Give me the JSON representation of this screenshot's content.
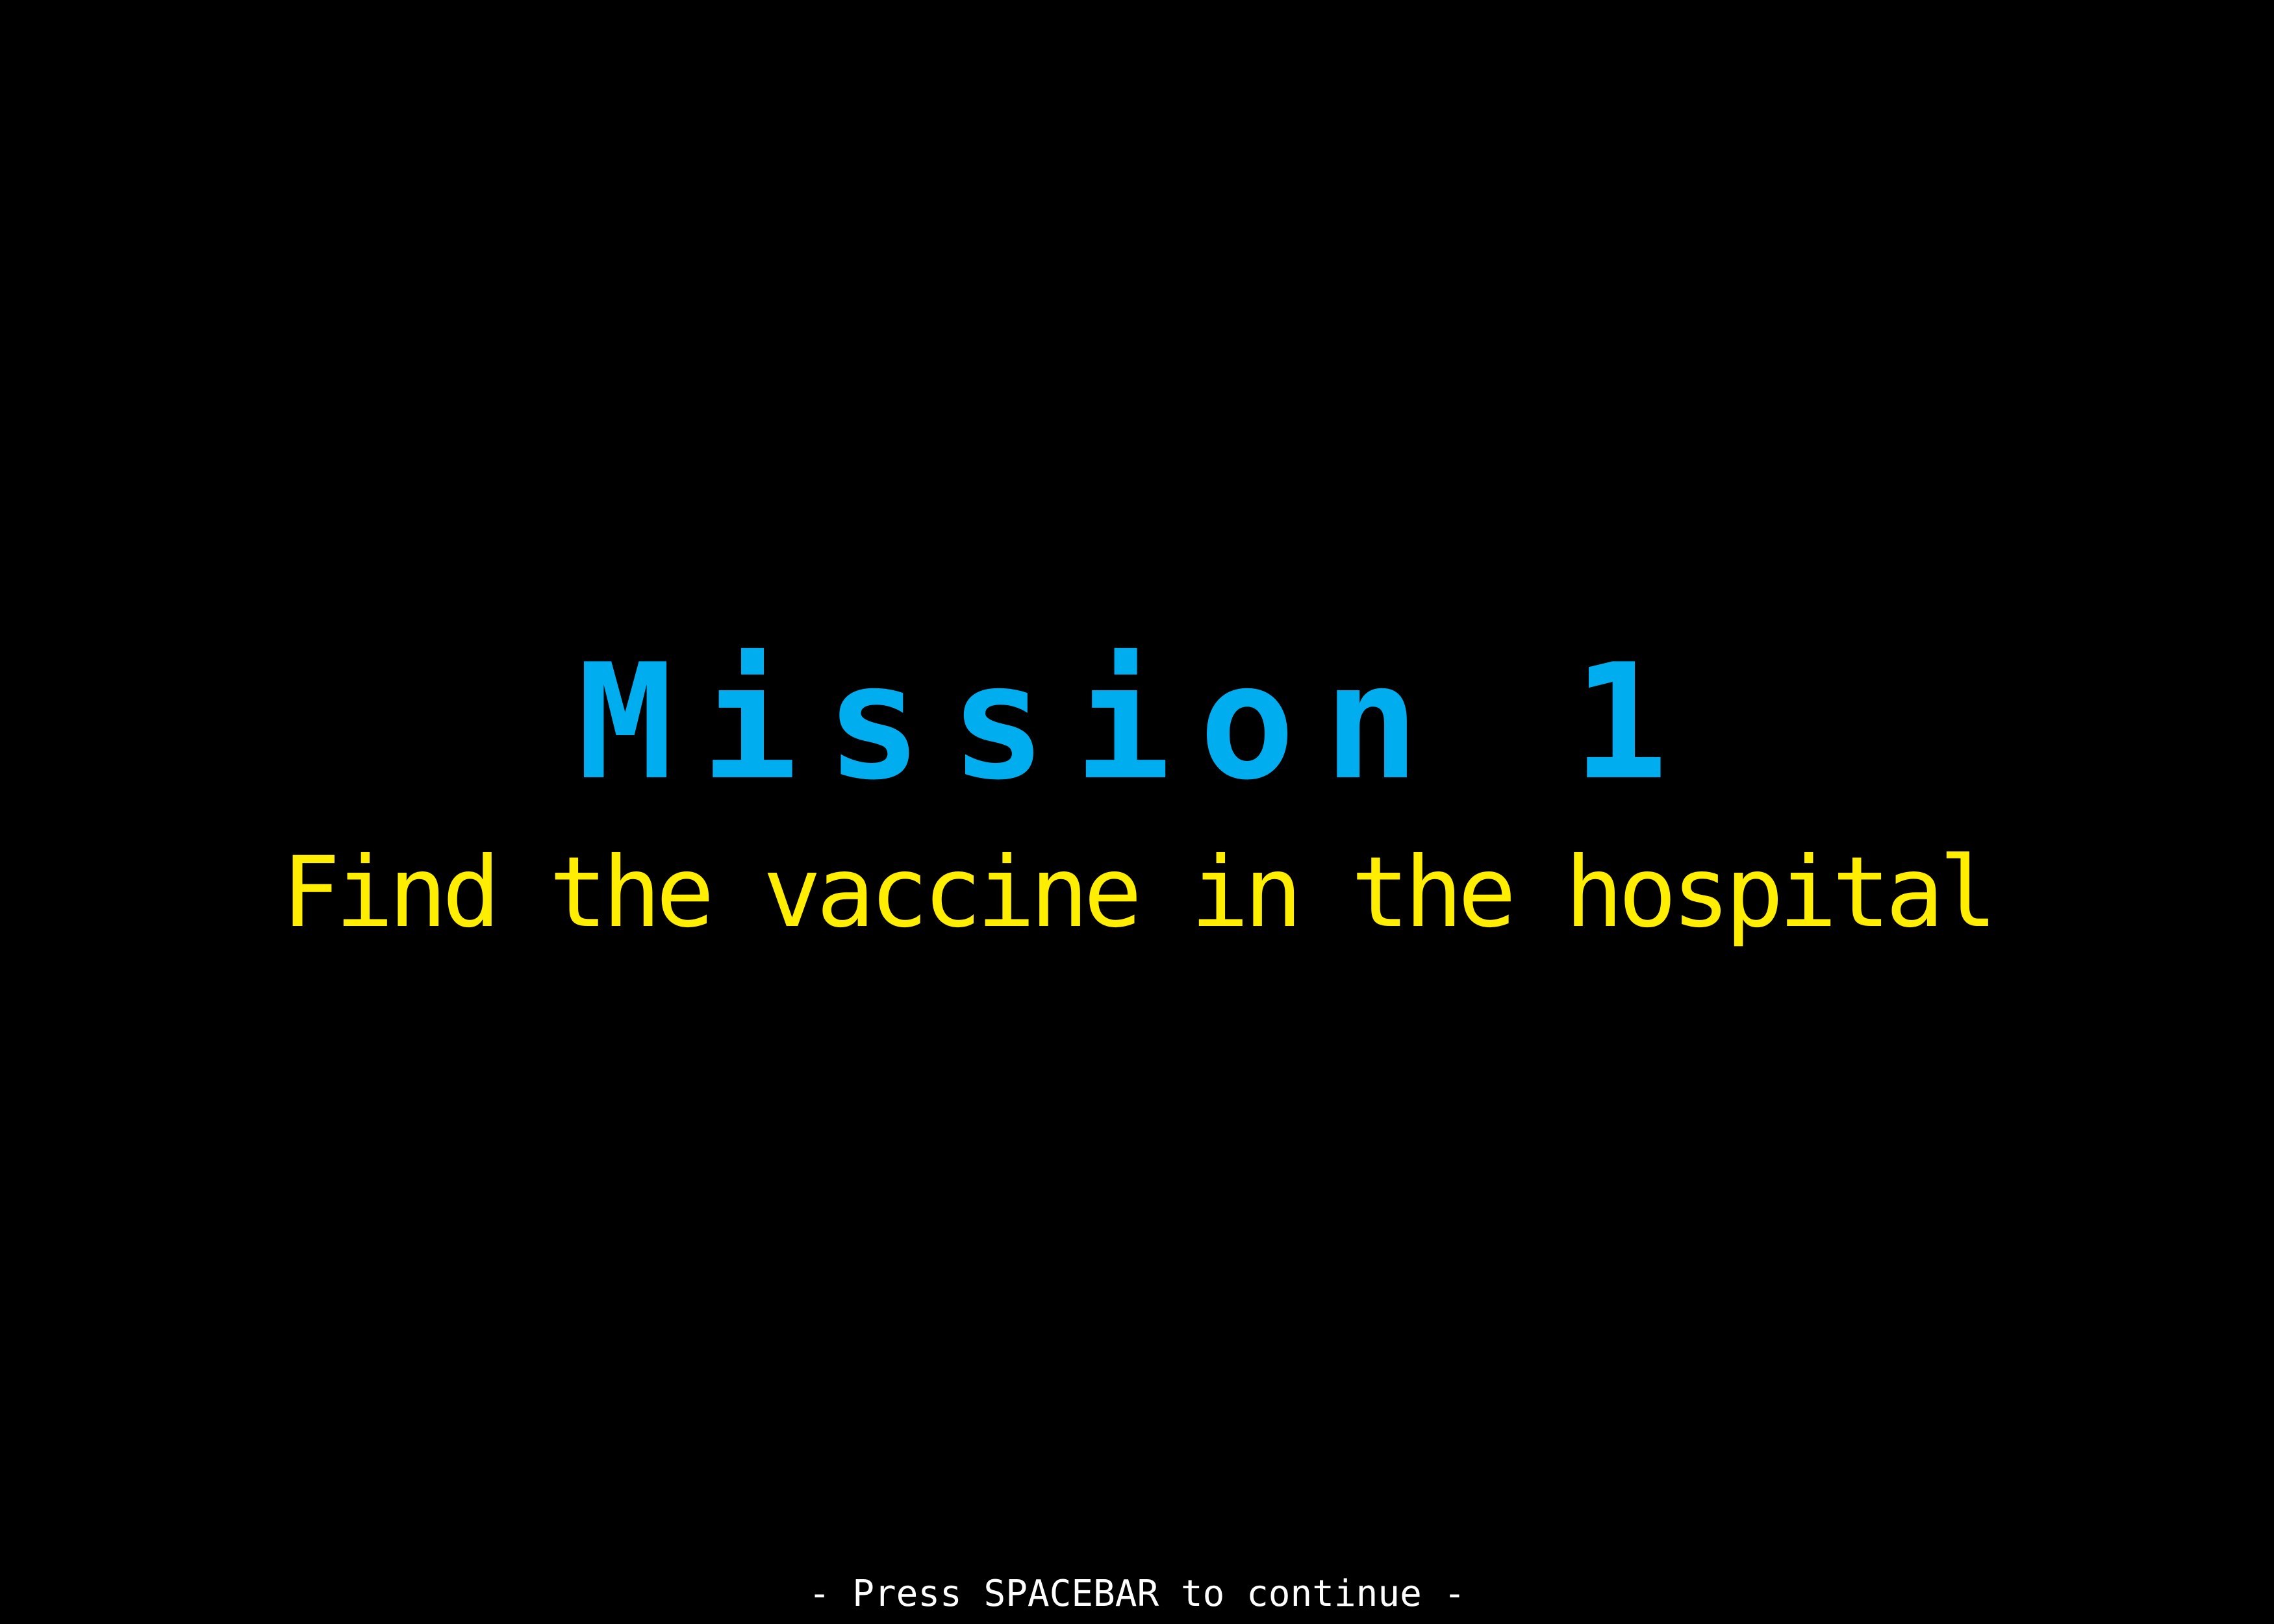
{
  "colors": {
    "background": "#000000",
    "title": "#00aeef",
    "objective": "#ffee00",
    "prompt": "#ffffff"
  },
  "mission": {
    "title": "Mission 1",
    "objective": "Find the vaccine in the hospital"
  },
  "prompt": {
    "continue_text": "- Press SPACEBAR to continue -"
  }
}
